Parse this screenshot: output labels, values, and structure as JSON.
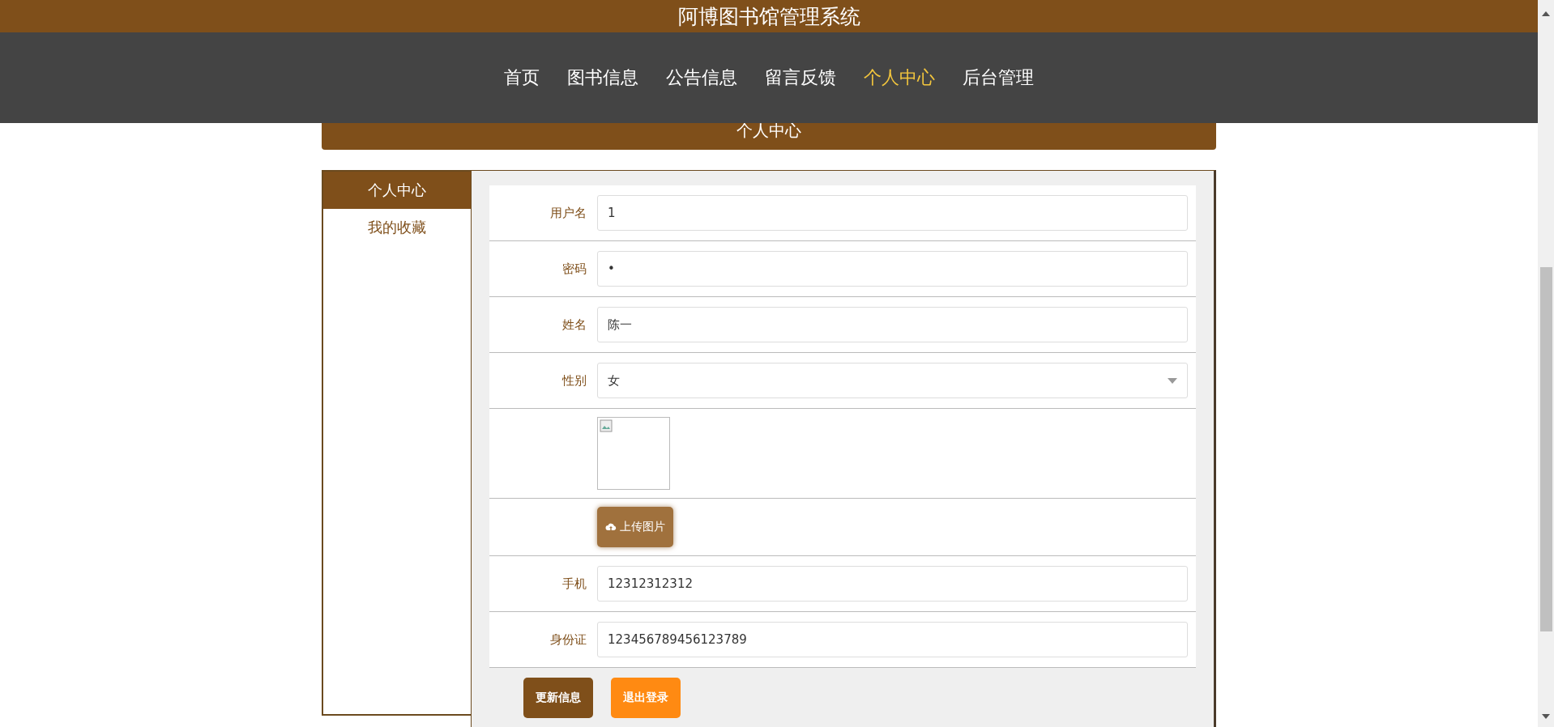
{
  "window": {
    "title": "阿博图书馆管理系统"
  },
  "nav": [
    {
      "label": "首页",
      "selected": false
    },
    {
      "label": "图书信息",
      "selected": false
    },
    {
      "label": "公告信息",
      "selected": false
    },
    {
      "label": "留言反馈",
      "selected": false
    },
    {
      "label": "个人中心",
      "selected": true
    },
    {
      "label": "后台管理",
      "selected": false
    }
  ],
  "section_title": "个人中心",
  "sidebar": {
    "items": [
      {
        "label": "个人中心",
        "selected": true
      },
      {
        "label": "我的收藏",
        "selected": false
      }
    ]
  },
  "form": {
    "fields": [
      {
        "kind": "text",
        "label": "用户名",
        "value": "1"
      },
      {
        "kind": "text",
        "label": "密码",
        "value": "•"
      },
      {
        "kind": "text",
        "label": "姓名",
        "value": "陈一"
      },
      {
        "kind": "select",
        "label": "性别",
        "value": "女"
      },
      {
        "kind": "image"
      },
      {
        "kind": "upload",
        "button": "上传图片"
      },
      {
        "kind": "text",
        "label": "手机",
        "value": "12312312312"
      },
      {
        "kind": "text",
        "label": "身份证",
        "value": "123456789456123789"
      }
    ],
    "buttons": [
      {
        "label": "更新信息",
        "kind": "primary"
      },
      {
        "label": "退出登录",
        "kind": "warning"
      }
    ]
  }
}
